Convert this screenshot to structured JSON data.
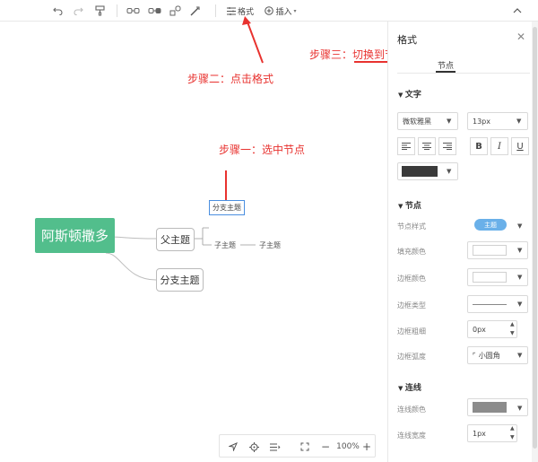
{
  "toolbar": {
    "format_label": "格式",
    "insert_label": "插入"
  },
  "canvas": {
    "root_node": "阿斯顿撒多",
    "parent_topic": "父主题",
    "branch_topic": "分支主题",
    "selected_node": "分支主题",
    "sub_topic_1": "子主题",
    "sub_topic_2": "子主题"
  },
  "annotations": {
    "step1": "步骤一：选中节点",
    "step2": "步骤二：点击格式",
    "step3": "步骤三：切换到节点",
    "color": "#e8322f"
  },
  "zoombar": {
    "zoom_level": "100%",
    "zoom_out": "−",
    "zoom_in": "+"
  },
  "panel": {
    "title": "格式",
    "tab_node": "节点",
    "text_section": "文字",
    "font_family": "微软雅黑",
    "font_size": "13px",
    "bold": "B",
    "italic": "I",
    "underline": "U",
    "node_section": "节点",
    "node_style_label": "节点样式",
    "node_style_pill": "主题",
    "fill_color_label": "填充颜色",
    "border_color_label": "边框颜色",
    "border_type_label": "边框类型",
    "border_width_label": "边框粗细",
    "border_width_value": "0px",
    "border_radius_label": "边框弧度",
    "border_radius_value": "小圆角",
    "line_section": "连线",
    "line_color_label": "连线颜色",
    "line_width_label": "连线宽度",
    "line_width_value": "1px",
    "text_color_swatch": "#3a3a3a",
    "line_color_swatch": "#8c8c8c",
    "accent": "#52be8c"
  }
}
